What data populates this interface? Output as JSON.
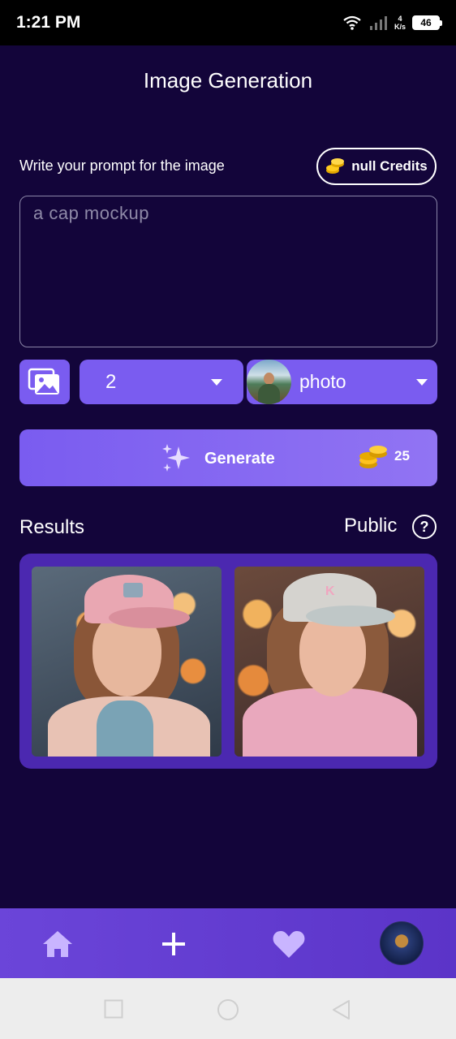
{
  "status_bar": {
    "time": "1:21 PM",
    "net_speed_value": "4",
    "net_speed_unit": "K/s",
    "battery": "46"
  },
  "header": {
    "title": "Image Generation"
  },
  "prompt": {
    "label": "Write your prompt for the image",
    "credits_label": "null Credits",
    "value": "a cap mockup"
  },
  "options": {
    "count_value": "2",
    "style_value": "photo"
  },
  "generate": {
    "label": "Generate",
    "cost": "25"
  },
  "results": {
    "title": "Results",
    "visibility_label": "Public",
    "help_symbol": "?",
    "images": [
      {
        "name": "result-image-1"
      },
      {
        "name": "result-image-2"
      }
    ]
  },
  "bottom_nav": {
    "items": [
      "home-icon",
      "plus-icon",
      "heart-icon",
      "profile-avatar"
    ]
  },
  "colors": {
    "background": "#13053a",
    "accent": "#7a5cf0",
    "panel": "#4b28b0",
    "nav": "#6b45d9"
  }
}
